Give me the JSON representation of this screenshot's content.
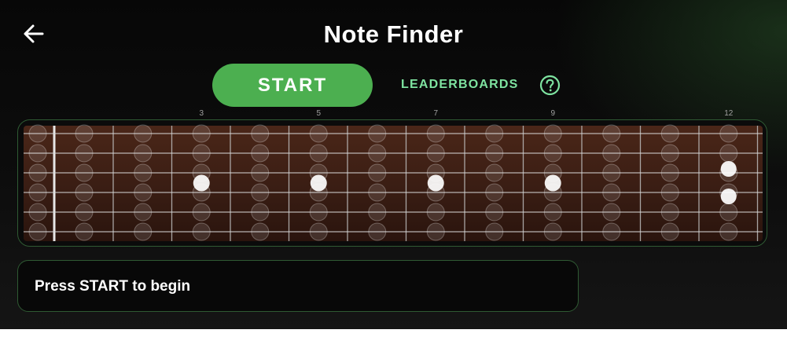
{
  "app": {
    "title": "Note Finder",
    "accent_color": "#4caf50",
    "link_color": "#7ee3a0"
  },
  "header": {
    "back_icon": "arrow-left-icon",
    "help_icon": "question-circle-icon"
  },
  "controls": {
    "start_label": "START",
    "leaderboards_label": "LEADERBOARDS"
  },
  "fretboard": {
    "strings": 6,
    "frets": 12,
    "marker_labels": [
      {
        "fret": 3,
        "label": "3"
      },
      {
        "fret": 5,
        "label": "5"
      },
      {
        "fret": 7,
        "label": "7"
      },
      {
        "fret": 9,
        "label": "9"
      },
      {
        "fret": 12,
        "label": "12"
      }
    ],
    "single_dot_frets": [
      3,
      5,
      7,
      9
    ],
    "double_dot_frets": [
      12
    ],
    "wood_color": "#3b1e14",
    "spot_color": "#ffffff"
  },
  "status": {
    "message": "Press START to begin"
  }
}
